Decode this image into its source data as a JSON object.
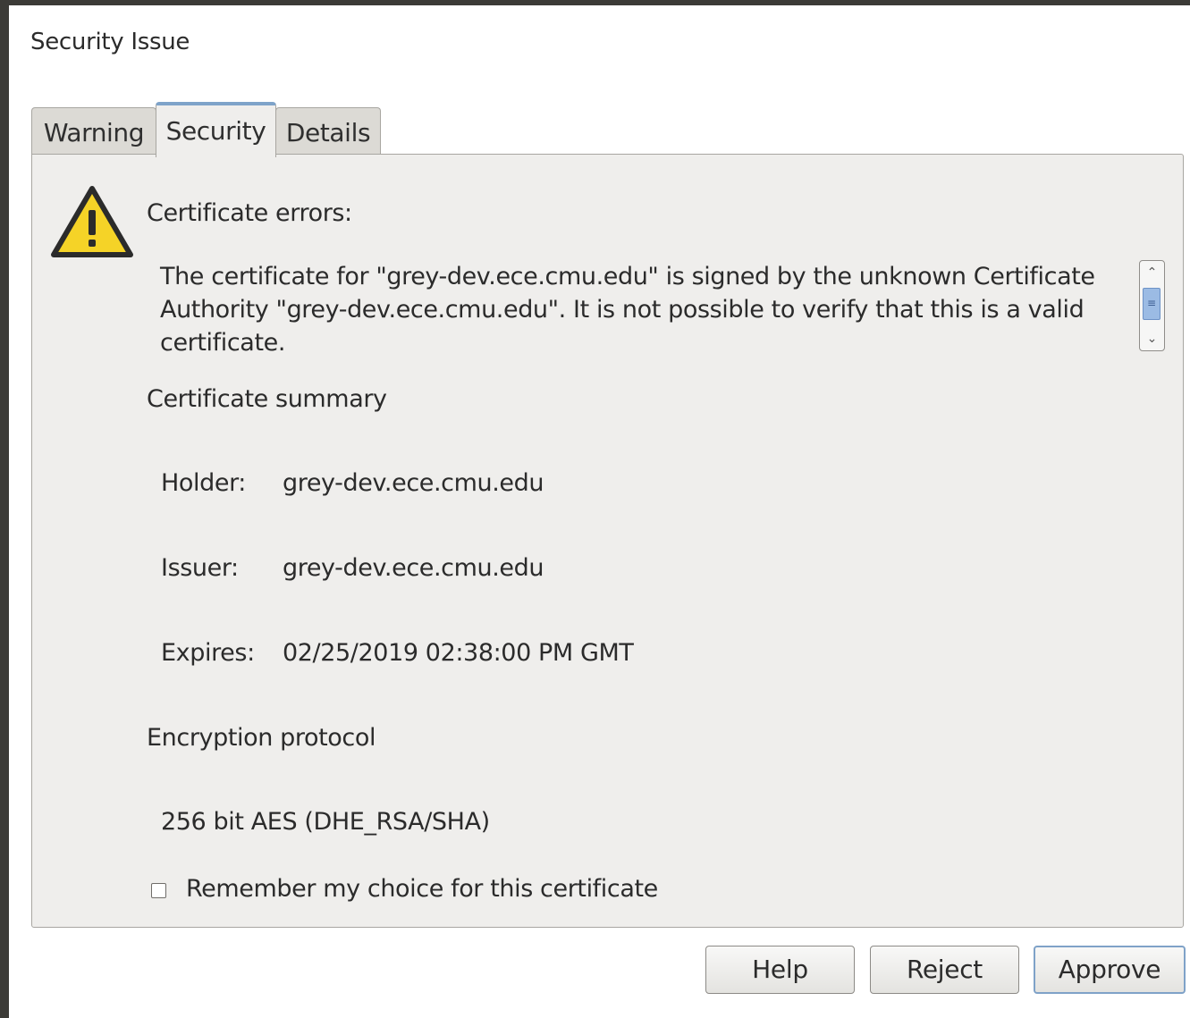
{
  "dialog": {
    "title": "Security Issue"
  },
  "tabs": [
    {
      "label": "Warning",
      "active": false
    },
    {
      "label": "Security",
      "active": true
    },
    {
      "label": "Details",
      "active": false
    }
  ],
  "security": {
    "icon": "warning-triangle-icon",
    "errors_heading": "Certificate errors:",
    "error_message": "The certificate for \"grey-dev.ece.cmu.edu\" is signed by the unknown Certificate Authority \"grey-dev.ece.cmu.edu\". It is not possible to verify that this is a valid certificate.",
    "summary_heading": "Certificate summary",
    "holder": {
      "label": "Holder:",
      "value": "grey-dev.ece.cmu.edu"
    },
    "issuer": {
      "label": "Issuer:",
      "value": "grey-dev.ece.cmu.edu"
    },
    "expires": {
      "label": "Expires:",
      "value": "02/25/2019 02:38:00 PM GMT"
    },
    "encryption_heading": "Encryption protocol",
    "encryption_value": "256 bit AES (DHE_RSA/SHA)",
    "remember_label": "Remember my choice for this certificate",
    "remember_checked": false
  },
  "buttons": {
    "help": "Help",
    "reject": "Reject",
    "approve": "Approve"
  },
  "colors": {
    "accent": "#7ea3c9",
    "warning_yellow": "#f5d327",
    "panel_bg": "#efeeec"
  }
}
